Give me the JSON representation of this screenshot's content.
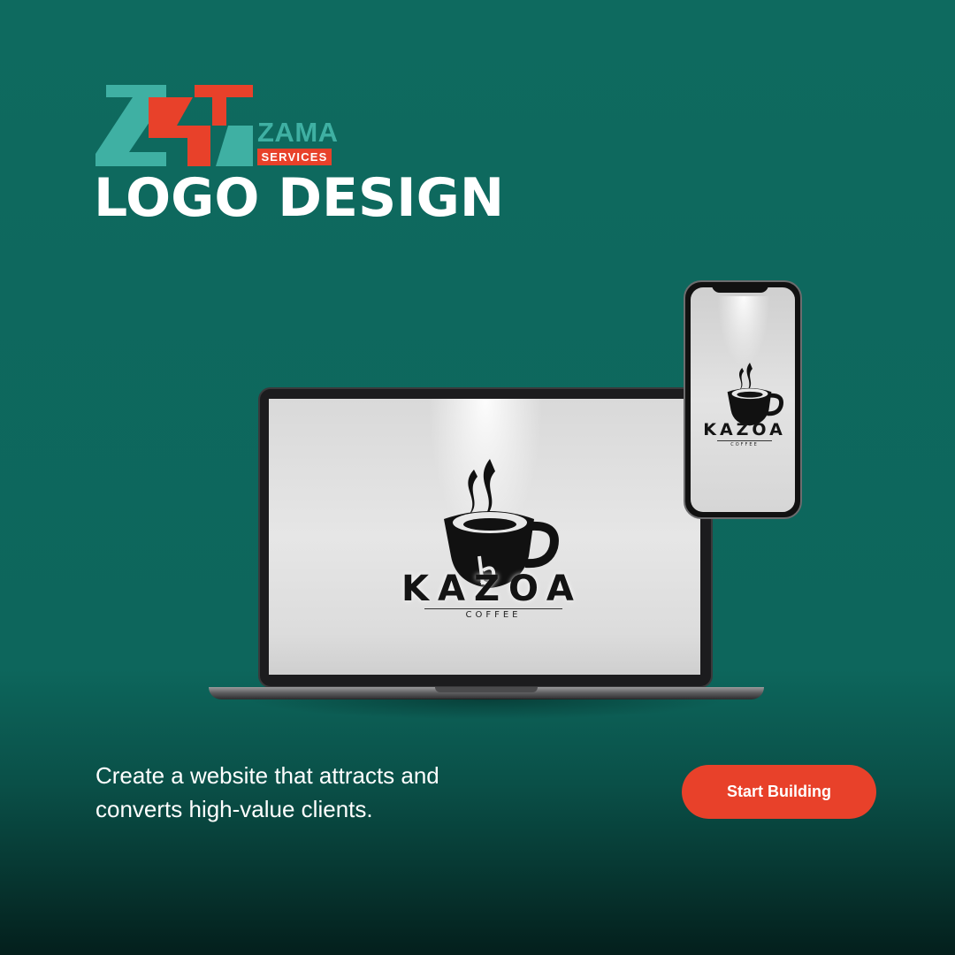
{
  "brand": {
    "name": "ZAMA",
    "tag": "SERVICES",
    "colors": {
      "teal": "#3fb0a3",
      "red": "#e8412a"
    }
  },
  "headline": "LOGO DESIGN",
  "mockup": {
    "logo_name": "KAZOA",
    "logo_sub": "COFFEE",
    "logo_icon": "coffee-cup-steam-icon"
  },
  "tagline": "Create a website that attracts and converts high-value clients.",
  "cta": {
    "label": "Start Building",
    "color": "#e8412a"
  },
  "colors": {
    "background": "#0e6a5f",
    "text": "#ffffff"
  }
}
